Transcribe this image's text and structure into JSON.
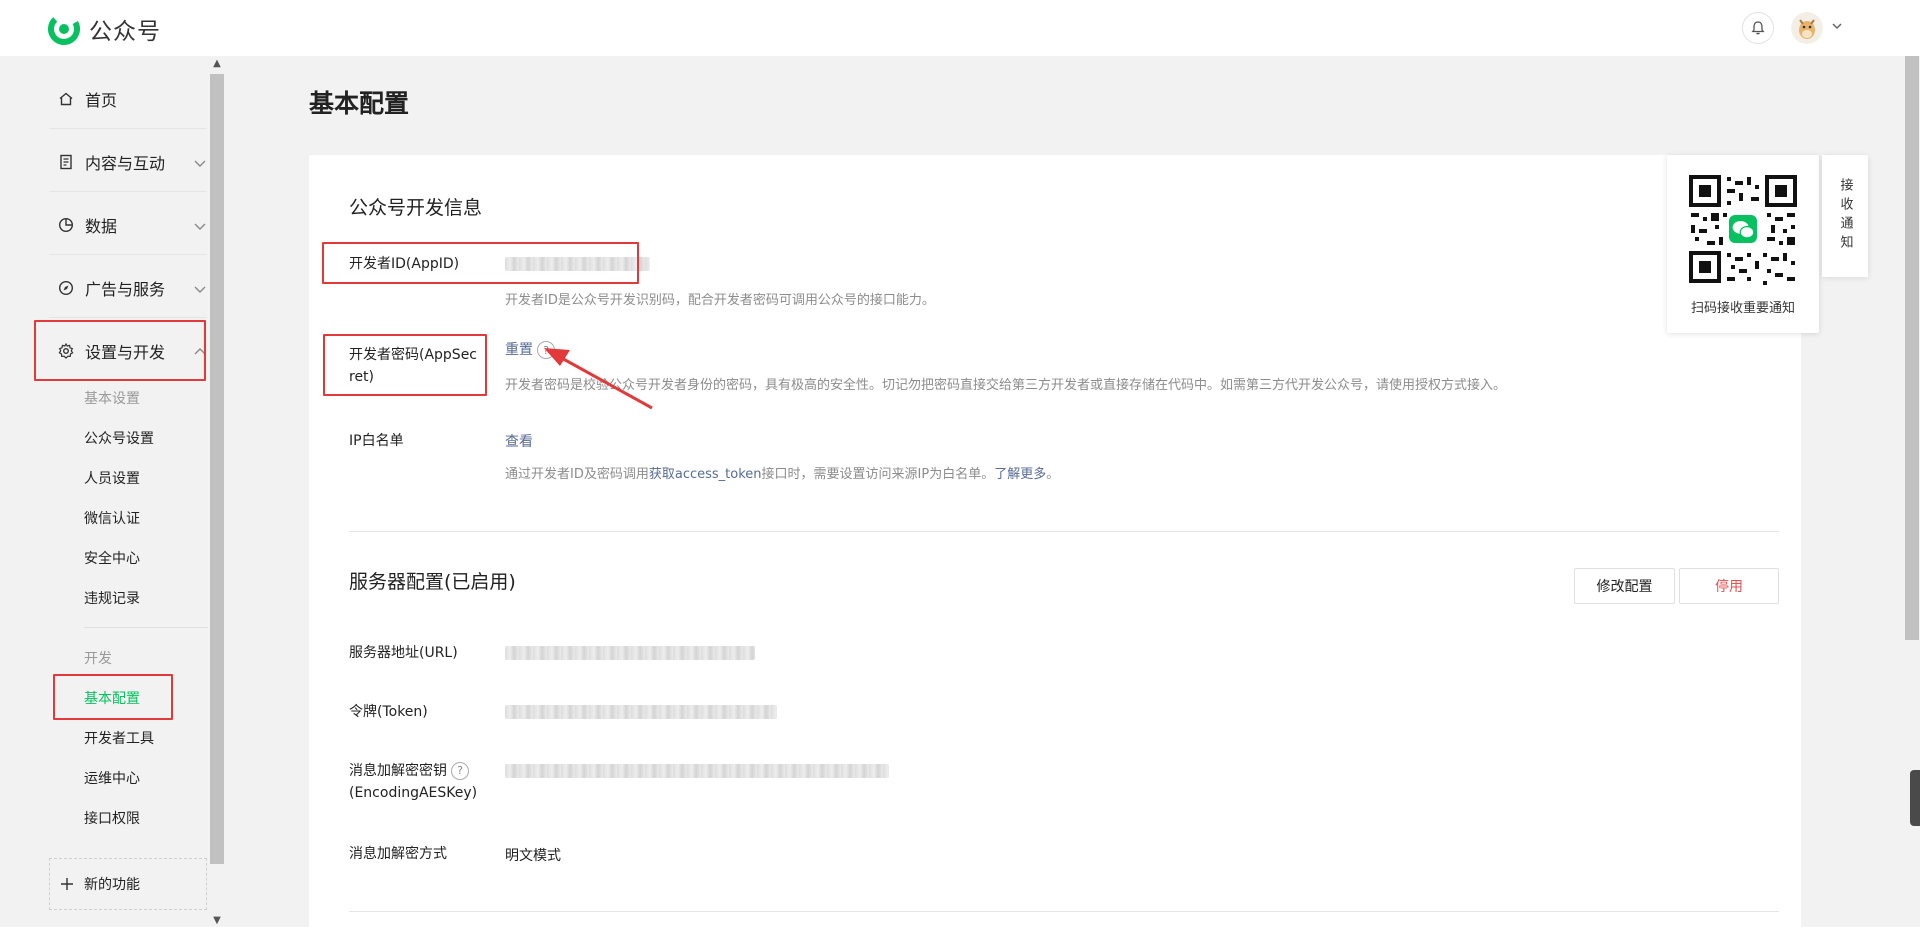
{
  "app": {
    "brand": "公众号",
    "brand_color": "#07c160"
  },
  "sidebar": {
    "nav": [
      {
        "label": "首页",
        "icon": "home-icon"
      },
      {
        "label": "内容与互动",
        "icon": "document-icon"
      },
      {
        "label": "数据",
        "icon": "pie-chart-icon"
      },
      {
        "label": "广告与服务",
        "icon": "compass-icon"
      },
      {
        "label": "设置与开发",
        "icon": "gear-icon"
      }
    ],
    "settings_group": {
      "header": "基本设置",
      "items": [
        "公众号设置",
        "人员设置",
        "微信认证",
        "安全中心",
        "违规记录"
      ]
    },
    "dev_group": {
      "header": "开发",
      "items": [
        "基本配置",
        "开发者工具",
        "运维中心",
        "接口权限"
      ],
      "active": "基本配置"
    },
    "new_feature": "新的功能"
  },
  "page": {
    "title": "基本配置"
  },
  "dev_info": {
    "title": "公众号开发信息",
    "appid_label": "开发者ID(AppID)",
    "appid_desc": "开发者ID是公众号开发识别码，配合开发者密码可调用公众号的接口能力。",
    "secret_label_1": "开发者密码(AppSec",
    "secret_label_2": "ret)",
    "secret_action": "重置",
    "secret_desc": "开发者密码是校验公众号开发者身份的密码，具有极高的安全性。切记勿把密码直接交给第三方开发者或直接存储在代码中。如需第三方代开发公众号，请使用授权方式接入。",
    "ip_label": "IP白名单",
    "ip_action": "查看",
    "ip_desc_pre": "通过开发者ID及密码调用",
    "ip_desc_link": "获取access_token",
    "ip_desc_mid": "接口时，需要设置访问来源IP为白名单。",
    "ip_desc_more": "了解更多",
    "ip_desc_end": "。"
  },
  "server_config": {
    "title": "服务器配置(已启用)",
    "modify_button": "修改配置",
    "disable_button": "停用",
    "url_label": "服务器地址(URL)",
    "token_label": "令牌(Token)",
    "aes_label_1": "消息加解密密钥",
    "aes_label_2": "(EncodingAESKey)",
    "mode_label": "消息加解密方式",
    "mode_value": "明文模式"
  },
  "qr_panel": {
    "caption": "扫码接收重要通知",
    "notify_tab": "接收通知"
  },
  "colors": {
    "highlight_box": "#e23a3a",
    "link": "#576b95",
    "danger": "#e84f4f",
    "active_nav": "#07c160"
  }
}
